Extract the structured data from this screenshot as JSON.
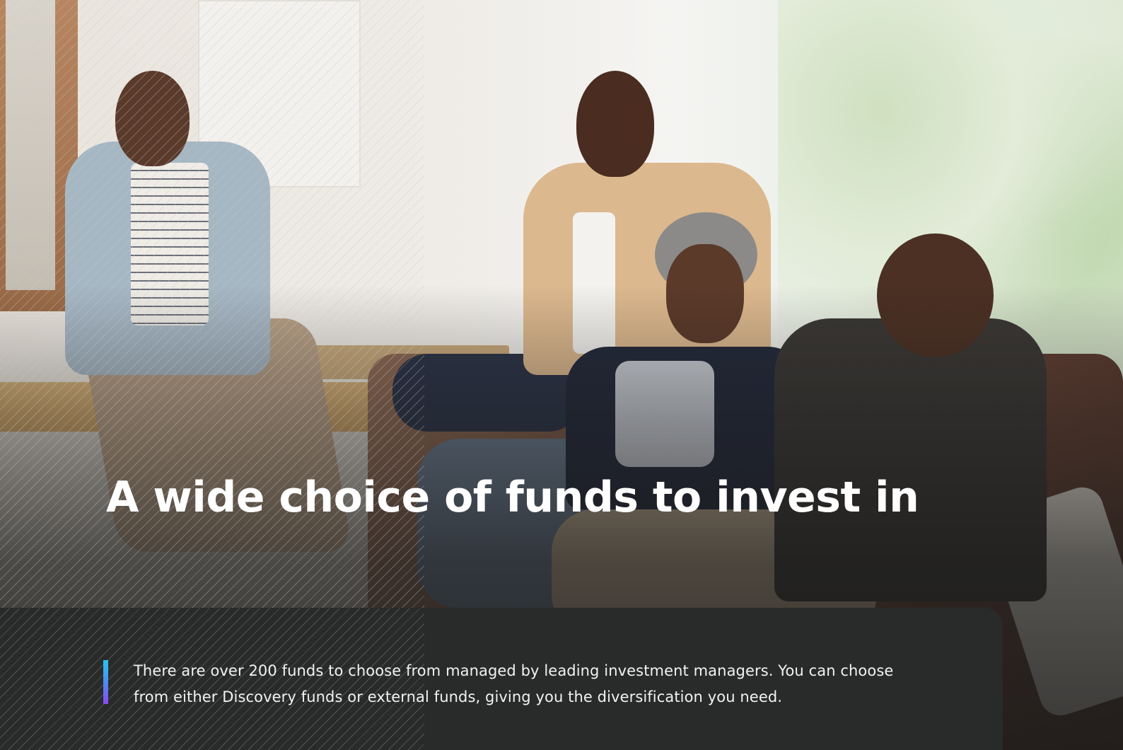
{
  "hero": {
    "title": "A wide choice of funds to invest in",
    "description": "There are over 200 funds to choose from managed by leading investment managers. You can choose from either Discovery funds or external funds, giving you the diversification you need."
  },
  "colors": {
    "panel_background": "#292a2a",
    "accent_gradient_top": "#29c4f0",
    "accent_gradient_bottom": "#8a4af0",
    "text": "#ffffff"
  }
}
